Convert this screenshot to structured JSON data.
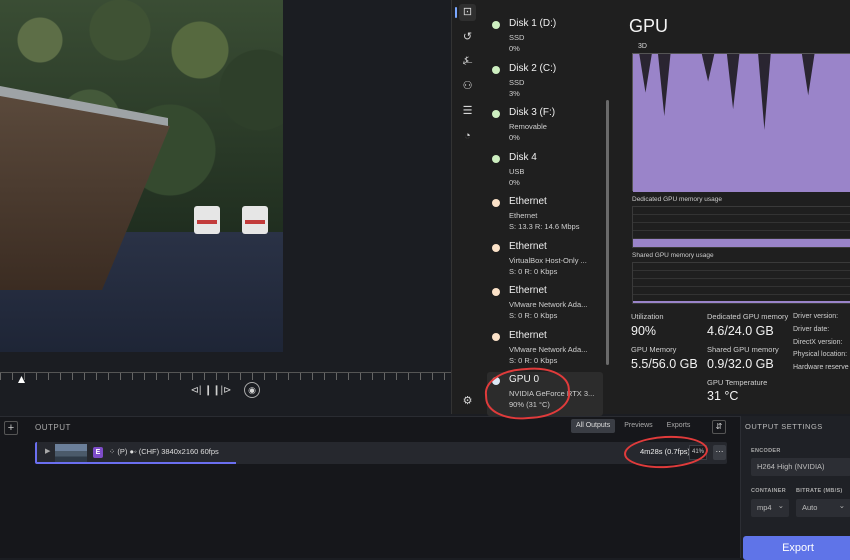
{
  "timeline": {
    "cut_icon": "⊲|",
    "pause_icon": "❙❙",
    "next_icon": "|⊳",
    "snapshot_icon": "◉"
  },
  "output": {
    "add_label": "+",
    "title": "OUTPUT",
    "tabs": [
      "All Outputs",
      "Previews",
      "Exports"
    ],
    "sort_icon": "⇵",
    "job": {
      "expand_icon": "▶",
      "badge": "E",
      "description": "⁘ (P)  ●◦ (CHF)  3840x2160  60fps",
      "eta": "4m28s (0.7fps)",
      "percent": "41%",
      "menu": "⋯",
      "progress": 0.41
    }
  },
  "settings": {
    "title": "OUTPUT SETTINGS",
    "encoder_label": "ENCODER",
    "encoder_value": "H264 High (NVIDIA)",
    "container_label": "CONTAINER",
    "container_value": "mp4",
    "bitrate_label": "BITRATE (MB/S)",
    "bitrate_value": "Auto",
    "chevron": "⌄",
    "export_label": "Export"
  },
  "taskmgr": {
    "nav_icons": [
      "⊡",
      "↺",
      "⍼",
      "⚇",
      "☰",
      "◔",
      "⚙"
    ],
    "devices": [
      {
        "name": "Disk 1 (D:)",
        "sub": "SSD",
        "val": "0%",
        "dot": "#cdeec0"
      },
      {
        "name": "Disk 2 (C:)",
        "sub": "SSD",
        "val": "3%",
        "dot": "#cdeec0"
      },
      {
        "name": "Disk 3 (F:)",
        "sub": "Removable",
        "val": "0%",
        "dot": "#cdeec0"
      },
      {
        "name": "Disk 4",
        "sub": "USB",
        "val": "0%",
        "dot": "#cdeec0"
      },
      {
        "name": "Ethernet",
        "sub": "Ethernet",
        "val": "S: 13.3  R: 14.6 Mbps",
        "dot": "#fbe2c8"
      },
      {
        "name": "Ethernet",
        "sub": "VirtualBox Host-Only ...",
        "val": "S: 0  R: 0 Kbps",
        "dot": "#fbe2c8"
      },
      {
        "name": "Ethernet",
        "sub": "VMware Network Ada...",
        "val": "S: 0  R: 0 Kbps",
        "dot": "#fbe2c8"
      },
      {
        "name": "Ethernet",
        "sub": "VMware Network Ada...",
        "val": "S: 0  R: 0 Kbps",
        "dot": "#fbe2c8"
      },
      {
        "name": "GPU 0",
        "sub": "NVIDIA GeForce RTX 3...",
        "val": "90%  (31 °C)",
        "dot": "#dbe8f5"
      }
    ],
    "gpu": {
      "title": "GPU",
      "graph_label": "3D",
      "dedicated_graph_label": "Dedicated GPU memory usage",
      "shared_graph_label": "Shared GPU memory usage",
      "utilization_label": "Utilization",
      "utilization_value": "90%",
      "gpu_memory_label": "GPU Memory",
      "gpu_memory_value": "5.5/56.0 GB",
      "dedicated_label": "Dedicated GPU memory",
      "dedicated_value": "4.6/24.0 GB",
      "shared_label": "Shared GPU memory",
      "shared_value": "0.9/32.0 GB",
      "temp_label": "GPU Temperature",
      "temp_value": "31 °C",
      "driver_version": "Driver version:",
      "driver_date": "Driver date:",
      "directx": "DirectX version:",
      "physical_location": "Physical location:",
      "hardware_reserved": "Hardware reserve",
      "graph_color": "#9a84c9",
      "utilization_history": [
        100,
        100,
        72,
        100,
        100,
        55,
        100,
        100,
        100,
        100,
        100,
        100,
        80,
        100,
        100,
        100,
        60,
        100,
        100,
        100,
        100,
        45,
        100,
        100,
        100,
        100,
        100,
        100,
        70,
        100,
        100,
        100,
        100,
        100,
        100,
        100
      ]
    }
  }
}
